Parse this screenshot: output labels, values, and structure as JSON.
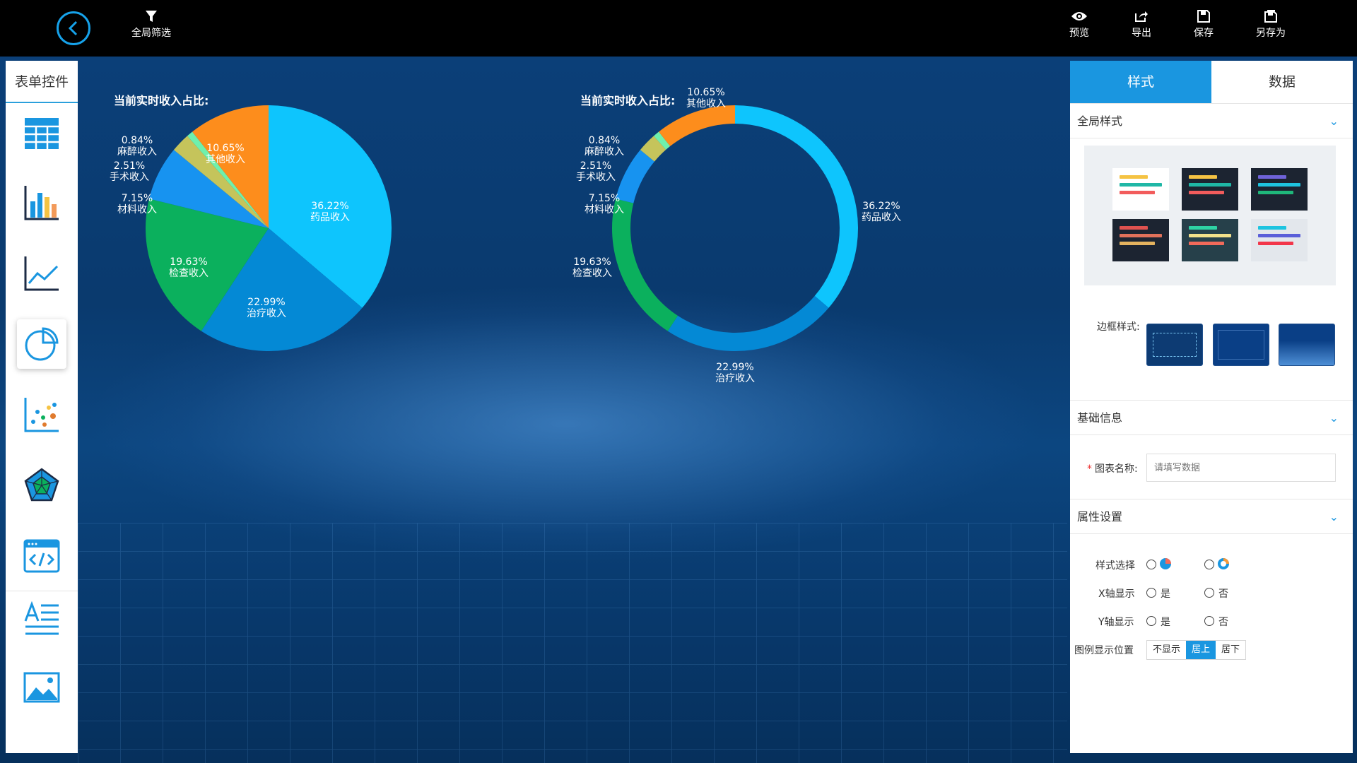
{
  "toolbar": {
    "filter_label": "全局筛选",
    "preview_label": "预览",
    "export_label": "导出",
    "save_label": "保存",
    "save_as_label": "另存为"
  },
  "left_panel": {
    "title": "表单控件",
    "items": [
      "table-icon",
      "bar-chart-icon",
      "line-chart-icon",
      "pie-chart-icon",
      "scatter-chart-icon",
      "radar-chart-icon",
      "code-icon",
      "text-icon",
      "image-icon"
    ]
  },
  "colors": {
    "drug": "#0ec5fd",
    "treatment": "#0489d5",
    "exam": "#0bb05d",
    "material": "#1793f0",
    "surgery": "#c5c45b",
    "anesthesia": "#6ff0ac",
    "other": "#fd8d1c",
    "accent": "#1a96e0"
  },
  "chart_data": [
    {
      "type": "pie",
      "title": "当前实时收入占比:",
      "slices": [
        {
          "name": "药品收入",
          "value": 36.22,
          "label": "36.22%"
        },
        {
          "name": "治疗收入",
          "value": 22.99,
          "label": "22.99%"
        },
        {
          "name": "检查收入",
          "value": 19.63,
          "label": "19.63%"
        },
        {
          "name": "材料收入",
          "value": 7.15,
          "label": "7.15%"
        },
        {
          "name": "手术收入",
          "value": 2.51,
          "label": "2.51%"
        },
        {
          "name": "麻醉收入",
          "value": 0.84,
          "label": "0.84%"
        },
        {
          "name": "其他收入",
          "value": 10.65,
          "label": "10.65%"
        }
      ]
    },
    {
      "type": "pie",
      "title": "当前实时收入占比:",
      "slices": [
        {
          "name": "药品收入",
          "value": 36.22,
          "label": "36.22%"
        },
        {
          "name": "治疗收入",
          "value": 22.99,
          "label": "22.99%"
        },
        {
          "name": "检查收入",
          "value": 19.63,
          "label": "19.63%"
        },
        {
          "name": "材料收入",
          "value": 7.15,
          "label": "7.15%"
        },
        {
          "name": "手术收入",
          "value": 2.51,
          "label": "2.51%"
        },
        {
          "name": "麻醉收入",
          "value": 0.84,
          "label": "0.84%"
        },
        {
          "name": "其他收入",
          "value": 10.65,
          "label": "10.65%"
        }
      ]
    }
  ],
  "right_panel": {
    "tab_style": "样式",
    "tab_data": "数据",
    "section_global": "全局样式",
    "border_style_label": "边框样式:",
    "section_basic": "基础信息",
    "chart_name_label": "图表名称:",
    "chart_name_required": "*",
    "chart_name_placeholder": "请填写数据",
    "section_props": "属性设置",
    "style_select_label": "样式选择",
    "x_axis_label": "X轴显示",
    "y_axis_label": "Y轴显示",
    "yes": "是",
    "no": "否",
    "legend_pos_label": "图例显示位置",
    "legend_options": [
      "不显示",
      "居上",
      "居下"
    ],
    "legend_selected": "居上"
  }
}
